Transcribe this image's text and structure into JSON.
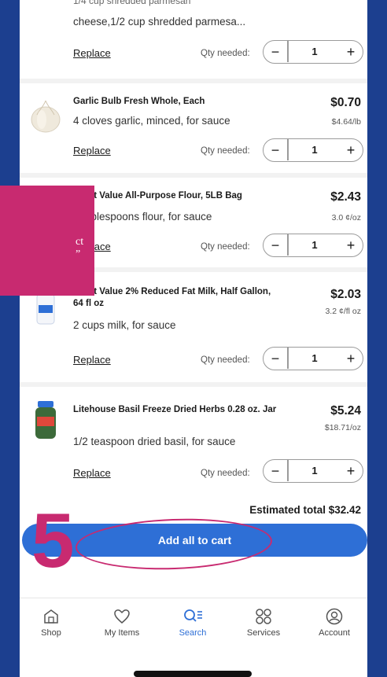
{
  "top_item": {
    "name_partial": "1/4 cup shredded parmesan",
    "detail": "cheese,1/2 cup shredded parmesa...",
    "replace_label": "Replace",
    "qty_label": "Qty needed:",
    "qty": "1"
  },
  "items": [
    {
      "name": "Garlic Bulb Fresh Whole, Each",
      "detail": "4 cloves garlic, minced, for sauce",
      "price": "$0.70",
      "unit_price": "$4.64/lb",
      "replace_label": "Replace",
      "qty_label": "Qty needed:",
      "qty": "1"
    },
    {
      "name": "Great Value All-Purpose Flour, 5LB Bag",
      "detail": "3 tablespoons flour, for sauce",
      "price": "$2.43",
      "unit_price": "3.0 ¢/oz",
      "replace_label": "Replace",
      "qty_label": "Qty needed:",
      "qty": "1"
    },
    {
      "name": "Great Value 2% Reduced Fat Milk, Half Gallon, 64 fl oz",
      "detail": "2 cups milk, for sauce",
      "price": "$2.03",
      "unit_price": "3.2 ¢/fl oz",
      "replace_label": "Replace",
      "qty_label": "Qty needed:",
      "qty": "1"
    },
    {
      "name": "Litehouse Basil Freeze Dried Herbs 0.28 oz. Jar",
      "detail": "1/2 teaspoon dried basil, for sauce",
      "price": "$5.24",
      "unit_price": "$18.71/oz",
      "replace_label": "Replace",
      "qty_label": "Qty needed:",
      "qty": "1"
    }
  ],
  "estimated_total": "Estimated total $32.42",
  "add_all_button": "Add all to cart",
  "annotation_number": "5",
  "banner_text": {
    "line1": "ct",
    "line2": "”"
  },
  "nav": [
    {
      "label": "Shop",
      "icon": "shop-icon"
    },
    {
      "label": "My Items",
      "icon": "heart-icon"
    },
    {
      "label": "Search",
      "icon": "search-icon"
    },
    {
      "label": "Services",
      "icon": "services-icon"
    },
    {
      "label": "Account",
      "icon": "account-icon"
    }
  ],
  "colors": {
    "frame_background": "#1c3f8f",
    "accent_blue": "#2e6fd6",
    "annotation_pink": "#c82a70"
  }
}
